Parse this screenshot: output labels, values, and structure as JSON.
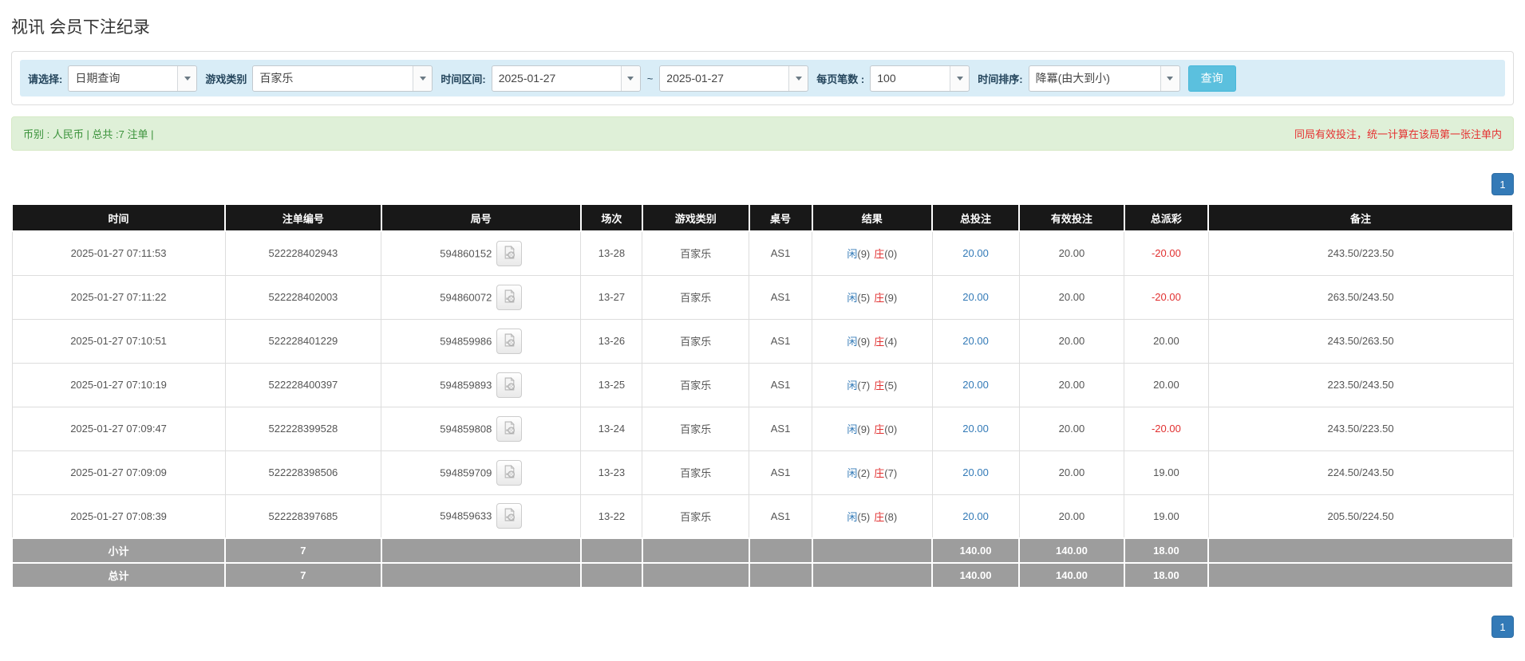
{
  "page": {
    "title": "视讯 会员下注纪录"
  },
  "filters": {
    "query_type": {
      "label": "请选择:",
      "value": "日期查询"
    },
    "game_category": {
      "label": "游戏类别",
      "value": "百家乐"
    },
    "date_range": {
      "label": "时间区间:",
      "from": "2025-01-27",
      "separator": "~",
      "to": "2025-01-27"
    },
    "page_size": {
      "label": "每页笔数 :",
      "value": "100"
    },
    "time_sort": {
      "label": "时间排序:",
      "value": "降冪(由大到小)"
    },
    "search_button": "查询"
  },
  "summary": {
    "left": "币别 : 人民币 | 总共 :7 注单 |",
    "right": "同局有效投注，统一计算在该局第一张注单内"
  },
  "pagination": {
    "page": "1"
  },
  "icons": {
    "dropdown_arrow": "triangle-down",
    "video_replay": "film-document"
  },
  "colors": {
    "filter_bar_bg": "#d9edf7",
    "summary_bg": "#dff0d8",
    "summary_text_green": "#3a923a",
    "summary_text_red": "#e53030",
    "search_button_bg": "#5bc0de",
    "pagination_bg": "#337ab7",
    "header_bg": "#181818",
    "totals_bg": "#9d9d9d",
    "link_blue": "#337ab7",
    "negative_red": "#e13030"
  },
  "table": {
    "headers": [
      "时间",
      "注单编号",
      "局号",
      "场次",
      "游戏类别",
      "桌号",
      "结果",
      "总投注",
      "有效投注",
      "总派彩",
      "备注"
    ],
    "rows": [
      {
        "time": "2025-01-27 07:11:53",
        "bet_id": "522228402943",
        "round_id": "594860152",
        "session": "13-28",
        "game": "百家乐",
        "table": "AS1",
        "result": {
          "player_label": "闲",
          "player": "(9)",
          "banker_label": "庄",
          "banker": "(0)"
        },
        "total_bet": "20.00",
        "valid_bet": "20.00",
        "payout": "-20.00",
        "note": "243.50/223.50"
      },
      {
        "time": "2025-01-27 07:11:22",
        "bet_id": "522228402003",
        "round_id": "594860072",
        "session": "13-27",
        "game": "百家乐",
        "table": "AS1",
        "result": {
          "player_label": "闲",
          "player": "(5)",
          "banker_label": "庄",
          "banker": "(9)"
        },
        "total_bet": "20.00",
        "valid_bet": "20.00",
        "payout": "-20.00",
        "note": "263.50/243.50"
      },
      {
        "time": "2025-01-27 07:10:51",
        "bet_id": "522228401229",
        "round_id": "594859986",
        "session": "13-26",
        "game": "百家乐",
        "table": "AS1",
        "result": {
          "player_label": "闲",
          "player": "(9)",
          "banker_label": "庄",
          "banker": "(4)"
        },
        "total_bet": "20.00",
        "valid_bet": "20.00",
        "payout": "20.00",
        "note": "243.50/263.50"
      },
      {
        "time": "2025-01-27 07:10:19",
        "bet_id": "522228400397",
        "round_id": "594859893",
        "session": "13-25",
        "game": "百家乐",
        "table": "AS1",
        "result": {
          "player_label": "闲",
          "player": "(7)",
          "banker_label": "庄",
          "banker": "(5)"
        },
        "total_bet": "20.00",
        "valid_bet": "20.00",
        "payout": "20.00",
        "note": "223.50/243.50"
      },
      {
        "time": "2025-01-27 07:09:47",
        "bet_id": "522228399528",
        "round_id": "594859808",
        "session": "13-24",
        "game": "百家乐",
        "table": "AS1",
        "result": {
          "player_label": "闲",
          "player": "(9)",
          "banker_label": "庄",
          "banker": "(0)"
        },
        "total_bet": "20.00",
        "valid_bet": "20.00",
        "payout": "-20.00",
        "note": "243.50/223.50"
      },
      {
        "time": "2025-01-27 07:09:09",
        "bet_id": "522228398506",
        "round_id": "594859709",
        "session": "13-23",
        "game": "百家乐",
        "table": "AS1",
        "result": {
          "player_label": "闲",
          "player": "(2)",
          "banker_label": "庄",
          "banker": "(7)"
        },
        "total_bet": "20.00",
        "valid_bet": "20.00",
        "payout": "19.00",
        "note": "224.50/243.50"
      },
      {
        "time": "2025-01-27 07:08:39",
        "bet_id": "522228397685",
        "round_id": "594859633",
        "session": "13-22",
        "game": "百家乐",
        "table": "AS1",
        "result": {
          "player_label": "闲",
          "player": "(5)",
          "banker_label": "庄",
          "banker": "(8)"
        },
        "total_bet": "20.00",
        "valid_bet": "20.00",
        "payout": "19.00",
        "note": "205.50/224.50"
      }
    ],
    "subtotal": {
      "label": "小计",
      "count": "7",
      "total_bet": "140.00",
      "valid_bet": "140.00",
      "payout": "18.00"
    },
    "total": {
      "label": "总计",
      "count": "7",
      "total_bet": "140.00",
      "valid_bet": "140.00",
      "payout": "18.00"
    }
  }
}
